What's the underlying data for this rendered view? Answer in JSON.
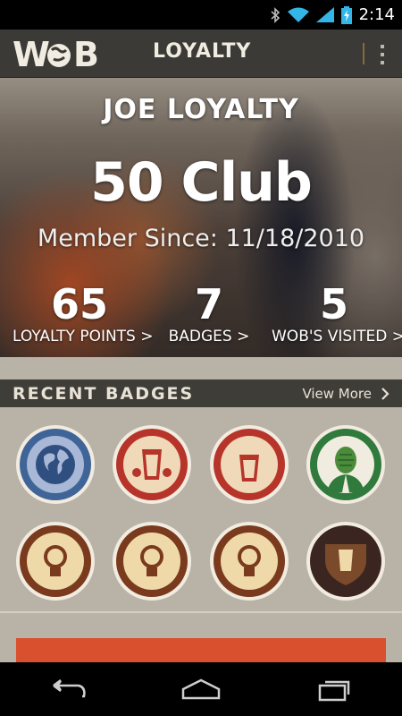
{
  "status_bar": {
    "time": "2:14",
    "icons": [
      "bluetooth-icon",
      "wifi-icon",
      "signal-icon",
      "battery-charging-icon"
    ]
  },
  "action_bar": {
    "logo_text": "WOB",
    "title": "LOYALTY",
    "menu_icon": "overflow-menu-icon"
  },
  "profile": {
    "name": "JOE LOYALTY",
    "club": "50 Club",
    "member_since": "Member Since: 11/18/2010"
  },
  "stats": [
    {
      "value": "65",
      "label": "LOYALTY POINTS >"
    },
    {
      "value": "7",
      "label": "BADGES >"
    },
    {
      "value": "5",
      "label": "WOB'S VISITED >"
    }
  ],
  "recent_badges": {
    "title": "RECENT BADGES",
    "view_more": "View More",
    "badges": [
      {
        "icon": "globe-badge-icon"
      },
      {
        "icon": "beer-glass-hops-badge-icon"
      },
      {
        "icon": "beer-glass-stars-badge-icon"
      },
      {
        "icon": "hop-man-badge-icon"
      },
      {
        "icon": "lightbulb-badge-icon"
      },
      {
        "icon": "lightbulb-badge-icon"
      },
      {
        "icon": "lightbulb-badge-icon"
      },
      {
        "icon": "shield-beer-badge-icon"
      }
    ]
  },
  "colors": {
    "accent": "#d8502e",
    "header_bar": "#3b3a36",
    "content_bg": "#b9b2a6"
  },
  "nav_bar": {
    "buttons": [
      "back-icon",
      "home-icon",
      "recent-apps-icon"
    ]
  }
}
